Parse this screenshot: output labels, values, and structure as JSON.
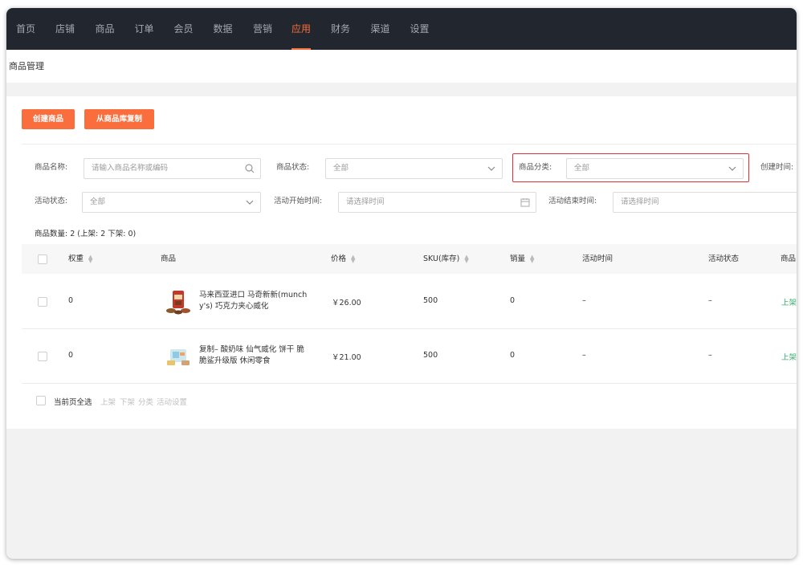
{
  "nav": {
    "items": [
      {
        "label": "首页",
        "active": false
      },
      {
        "label": "店铺",
        "active": false
      },
      {
        "label": "商品",
        "active": false
      },
      {
        "label": "订单",
        "active": false
      },
      {
        "label": "会员",
        "active": false
      },
      {
        "label": "数据",
        "active": false
      },
      {
        "label": "营销",
        "active": false
      },
      {
        "label": "应用",
        "active": true
      },
      {
        "label": "财务",
        "active": false
      },
      {
        "label": "渠道",
        "active": false
      },
      {
        "label": "设置",
        "active": false
      }
    ]
  },
  "page": {
    "title": "商品管理"
  },
  "actions": {
    "create": "创建商品",
    "copy": "从商品库复制"
  },
  "filters": {
    "name": {
      "label": "商品名称:",
      "placeholder": "请输入商品名称或编码"
    },
    "status": {
      "label": "商品状态:",
      "value": "全部"
    },
    "category": {
      "label": "商品分类:",
      "value": "全部"
    },
    "created": {
      "label": "创建时间:"
    },
    "activity_status": {
      "label": "活动状态:",
      "value": "全部"
    },
    "activity_start": {
      "label": "活动开始时间:",
      "placeholder": "请选择时间"
    },
    "activity_end": {
      "label": "活动结束时间:",
      "placeholder": "请选择时间"
    }
  },
  "summary": "商品数量: 2 (上架: 2 下架: 0)",
  "table": {
    "headers": {
      "weight": "权重",
      "product": "商品",
      "price": "价格",
      "sku": "SKU(库存)",
      "sales": "销量",
      "activity_time": "活动时间",
      "activity_status": "活动状态",
      "product_status": "商品"
    },
    "rows": [
      {
        "weight": "0",
        "name": "马来西亚进口 马奇新新(munchy's) 巧克力夹心威化",
        "price": "￥26.00",
        "sku": "500",
        "sales": "0",
        "activity_time": "–",
        "activity_status": "–",
        "status": "上架"
      },
      {
        "weight": "0",
        "name": "复制– 酸奶味 仙气威化 饼干 脆脆鲨升级版 休闲零食",
        "price": "￥21.00",
        "sku": "500",
        "sales": "0",
        "activity_time": "–",
        "activity_status": "–",
        "status": "上架"
      }
    ]
  },
  "footer": {
    "select_all": "当前页全选",
    "batch": [
      "上架",
      "下架",
      "分类",
      "活动设置"
    ]
  },
  "colors": {
    "accent": "#fa6d3d",
    "nav_bg": "#22262e",
    "highlight": "#e0303a",
    "status_green": "#3cb371"
  }
}
